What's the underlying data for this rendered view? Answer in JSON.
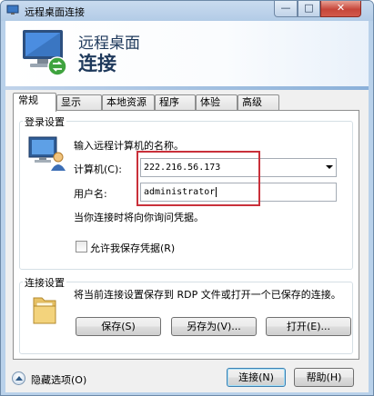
{
  "window": {
    "title": "远程桌面连接",
    "minimize_glyph": "—",
    "maximize_glyph": "□",
    "close_glyph": "✕"
  },
  "banner": {
    "title_line1": "远程桌面",
    "title_line2": "连接"
  },
  "tabs": [
    {
      "label": "常规"
    },
    {
      "label": "显示"
    },
    {
      "label": "本地资源"
    },
    {
      "label": "程序"
    },
    {
      "label": "体验"
    },
    {
      "label": "高级"
    }
  ],
  "login": {
    "group_label": "登录设置",
    "prompt": "输入远程计算机的名称。",
    "computer_label": "计算机(C):",
    "computer_value": "222.216.56.173",
    "username_label": "用户名:",
    "username_value": "administrator",
    "hint": "当你连接时将向你询问凭据。",
    "save_credentials_label": "允许我保存凭据(R)"
  },
  "connection": {
    "group_label": "连接设置",
    "description": "将当前连接设置保存到 RDP 文件或打开一个已保存的连接。",
    "save_label": "保存(S)",
    "save_as_label": "另存为(V)...",
    "open_label": "打开(E)..."
  },
  "footer": {
    "hide_options_label": "隐藏选项(O)",
    "connect_label": "连接(N)",
    "help_label": "帮助(H)"
  },
  "colors": {
    "highlight": "#c9303a",
    "banner_text": "#1e395b"
  }
}
